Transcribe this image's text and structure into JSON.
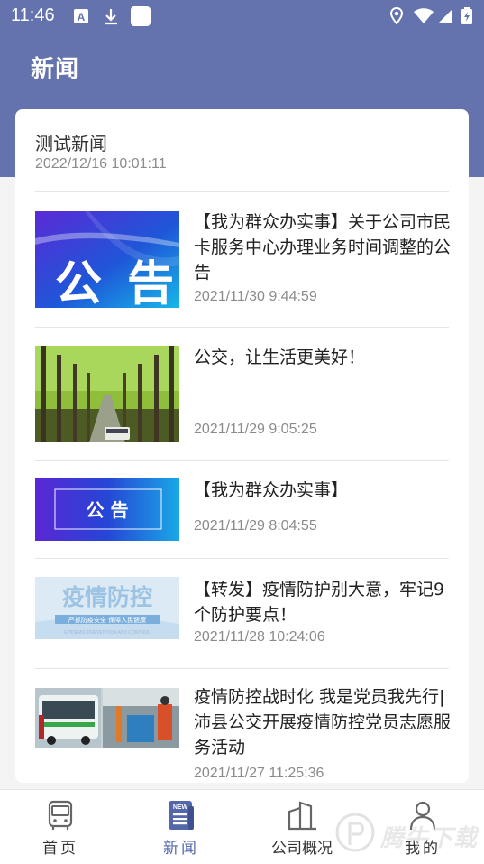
{
  "status_bar": {
    "time": "11:46",
    "icons": [
      "a-icon",
      "download-icon",
      "square-icon",
      "location-icon",
      "wifi-icon",
      "signal-icon",
      "battery-icon"
    ]
  },
  "header": {
    "title": "新闻"
  },
  "headline": {
    "title": "测试新闻",
    "date": "2022/12/16 10:01:11"
  },
  "news": [
    {
      "title": "【我为群众办实事】关于公司市民卡服务中心办理业务时间调整的公告",
      "date": "2021/11/30 9:44:59",
      "thumb_text": "公 告"
    },
    {
      "title": "公交，让生活更美好！",
      "date": "2021/11/29 9:05:25"
    },
    {
      "title": "【我为群众办实事】",
      "date": "2021/11/29 8:04:55",
      "thumb_text": "公 告"
    },
    {
      "title": "【转发】疫情防护别大意，牢记9个防护要点！",
      "date": "2021/11/28 10:24:06",
      "thumb_text": "疫情防控",
      "thumb_sub": "严抓防疫安全 保障人民健康",
      "thumb_en": "EPIDEMIC PREVENTION AND CONTROL"
    },
    {
      "title": "疫情防控战时化 我是党员我先行|沛县公交开展疫情防控党员志愿服务活动",
      "date": "2021/11/27 11:25:36"
    }
  ],
  "tabs": [
    {
      "label": "首页",
      "icon": "bus-icon"
    },
    {
      "label": "新闻",
      "icon": "news-icon",
      "badge": "NEW"
    },
    {
      "label": "公司概况",
      "icon": "building-icon"
    },
    {
      "label": "我的",
      "icon": "user-icon"
    }
  ],
  "watermark": "腾牛下载",
  "colors": {
    "header": "#6472ae",
    "accent": "#5467a8",
    "muted": "#8b8b8b"
  }
}
